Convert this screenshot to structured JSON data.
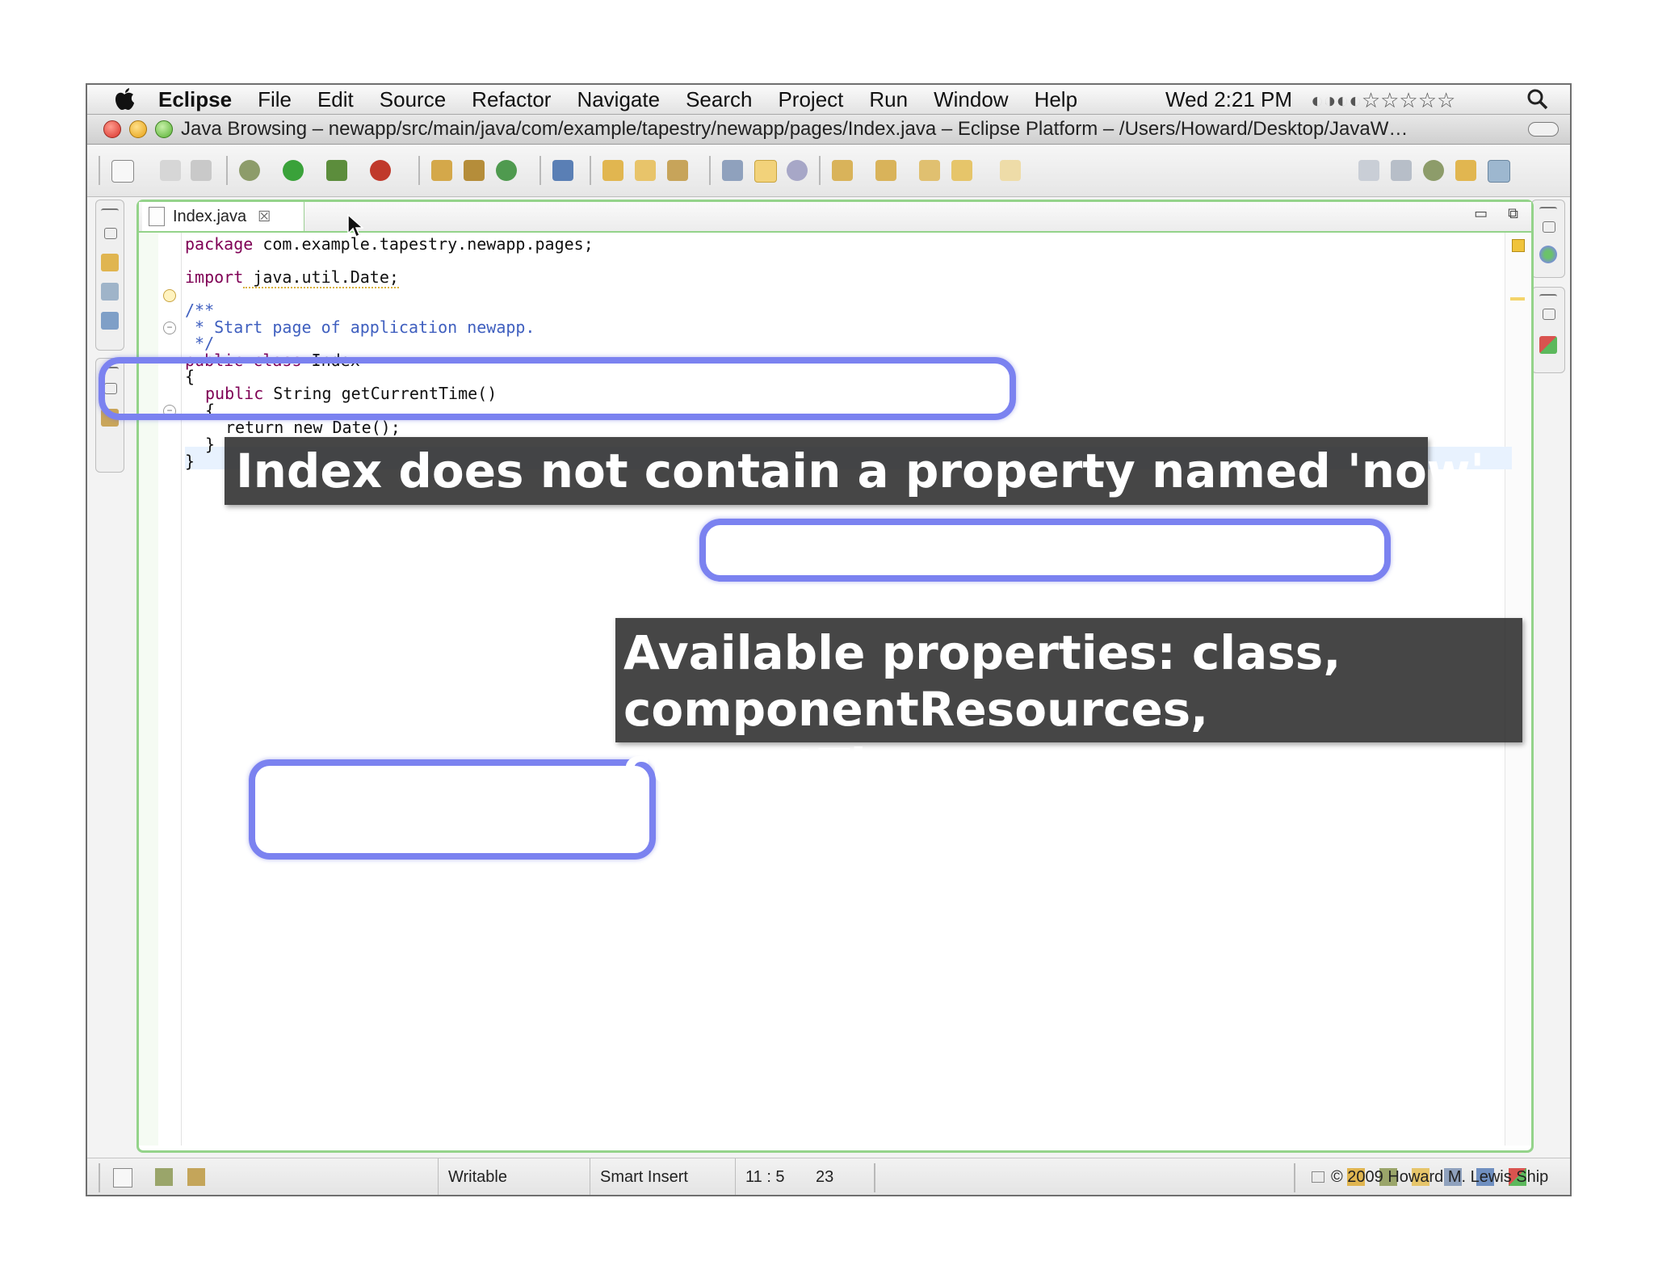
{
  "menubar": {
    "app_name": "Eclipse",
    "items": [
      "File",
      "Edit",
      "Source",
      "Refactor",
      "Navigate",
      "Search",
      "Project",
      "Run",
      "Window",
      "Help"
    ],
    "clock": "Wed 2:21 PM",
    "status_glyphs": "◐◑◐◐☆☆☆☆☆"
  },
  "window": {
    "title": "Java Browsing – newapp/src/main/java/com/example/tapestry/newapp/pages/Index.java – Eclipse Platform – /Users/Howard/Desktop/JavaW…"
  },
  "editor": {
    "tab_label": "Index.java",
    "tab_close": "☒",
    "code_lines": [
      {
        "kw": "package",
        "rest": " com.example.tapestry.newapp.pages;"
      },
      {
        "kw": "import",
        "rest": " java.util.Date;"
      },
      {
        "cm": "/**"
      },
      {
        "cm": " * Start page of application newapp."
      },
      {
        "cm": " */"
      },
      {
        "kw": "public class",
        "rest": " Index"
      },
      {
        "plain": "{"
      },
      {
        "kw": "public",
        "rest": " String getCurrentTime()"
      },
      {
        "plain": "{"
      },
      {
        "plain": "return new Date();"
      },
      {
        "plain": "}"
      },
      {
        "plain": "}"
      }
    ]
  },
  "statusbar": {
    "writable": "Writable",
    "insert_mode": "Smart Insert",
    "position": "11 : 5"
  },
  "slide": {
    "number": "23",
    "copyright": "© 2009 Howard M. Lewis Ship"
  },
  "overlay": {
    "banner1": "Index does not contain a property named 'now'",
    "banner2_line1": "Available properties: class,",
    "banner2_line2": "componentResources, currentTime"
  },
  "colors": {
    "callout": "#7b82f0",
    "editor_border": "#94d38a",
    "keyword": "#7f0055",
    "comment": "#3f5fbf"
  }
}
